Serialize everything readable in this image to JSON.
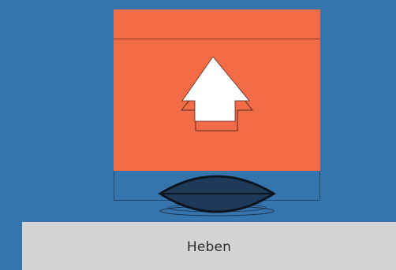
{
  "action": {
    "label": "Heben"
  },
  "icons": {
    "lift_arrow": "arrow-up-icon",
    "lens": "lens-icon"
  },
  "colors": {
    "background": "#3674ad",
    "panel": "#f26c48",
    "button": "#d4d4d4",
    "lens": "#1e3a58"
  }
}
